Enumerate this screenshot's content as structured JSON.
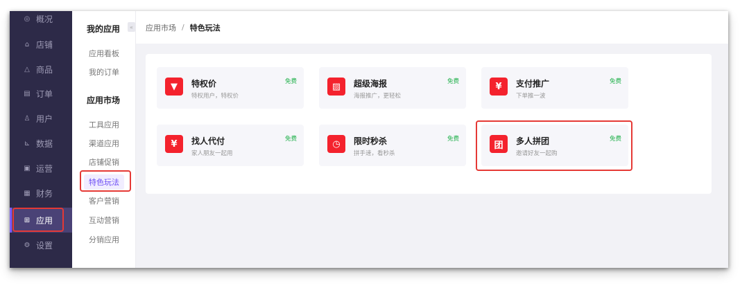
{
  "nav": {
    "items": [
      {
        "icon": "◎",
        "label": "概况"
      },
      {
        "icon": "⌂",
        "label": "店铺"
      },
      {
        "icon": "△",
        "label": "商品"
      },
      {
        "icon": "▤",
        "label": "订单"
      },
      {
        "icon": "♙",
        "label": "用户"
      },
      {
        "icon": "⊾",
        "label": "数据"
      },
      {
        "icon": "▣",
        "label": "运营"
      },
      {
        "icon": "▦",
        "label": "财务"
      },
      {
        "icon": "⊞",
        "label": "应用"
      },
      {
        "icon": "⚙",
        "label": "设置"
      }
    ],
    "active": "应用"
  },
  "subnav": {
    "collapse_glyph": "«",
    "my_apps_title": "我的应用",
    "my_apps": [
      "应用看板",
      "我的订单"
    ],
    "market_title": "应用市场",
    "market": [
      "工具应用",
      "渠道应用",
      "店铺促销",
      "特色玩法",
      "客户营销",
      "互动营销",
      "分销应用"
    ],
    "active": "特色玩法"
  },
  "breadcrumb": {
    "parent": "应用市场",
    "separator": "/",
    "current": "特色玩法"
  },
  "cards": [
    {
      "icon_glyph": "▼",
      "title": "特权价",
      "desc": "特权用户，特权价",
      "tag": "免费"
    },
    {
      "icon_glyph": "▨",
      "title": "超级海报",
      "desc": "海报推广，更轻松",
      "tag": "免费"
    },
    {
      "icon_glyph": "¥",
      "title": "支付推广",
      "desc": "下单推一波",
      "tag": "免费"
    },
    {
      "icon_glyph": "¥",
      "title": "找人代付",
      "desc": "家人朋友一起用",
      "tag": "免费"
    },
    {
      "icon_glyph": "◷",
      "title": "限时秒杀",
      "desc": "拼手速，看秒杀",
      "tag": "免费"
    },
    {
      "icon_glyph": "团",
      "title": "多人拼团",
      "desc": "邀请好友一起购",
      "tag": "免费"
    }
  ],
  "colors": {
    "nav_bg": "#2d2a48",
    "accent": "#6a4cf5",
    "card_icon_red": "#f4222d",
    "free_tag_green": "#22b14c",
    "highlight_red": "#e53935"
  }
}
